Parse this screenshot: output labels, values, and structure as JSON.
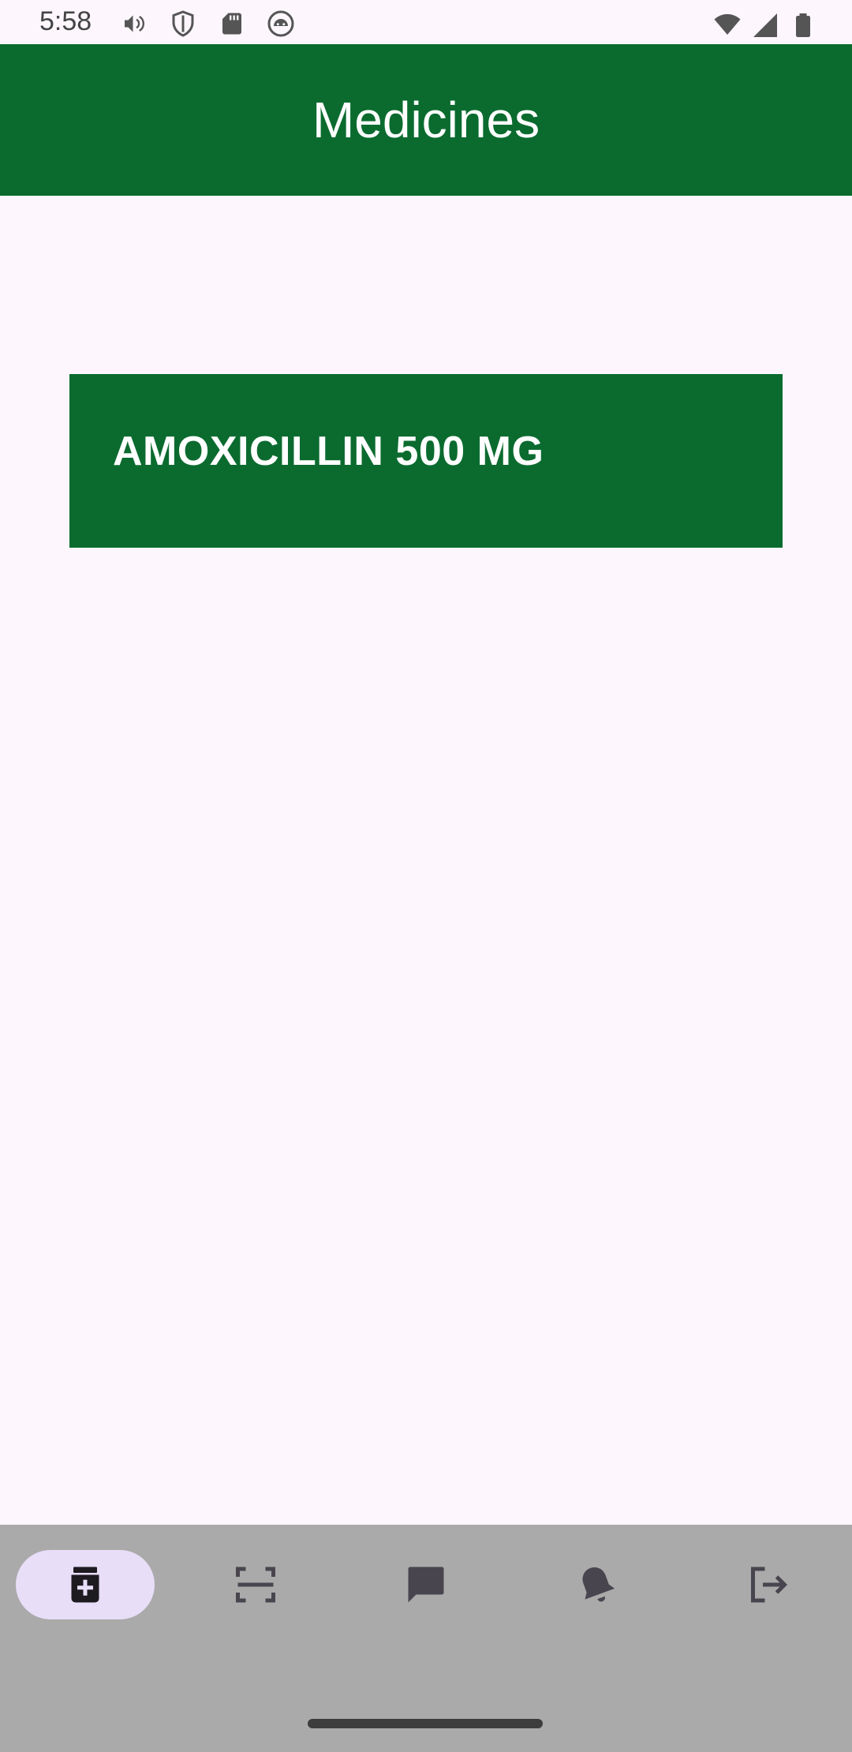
{
  "status_bar": {
    "time": "5:58",
    "left_icons": [
      "volume-icon",
      "shield-icon",
      "sd-card-icon",
      "android-face-icon"
    ],
    "right_icons": [
      "wifi-icon",
      "cell-signal-icon",
      "battery-icon"
    ]
  },
  "app_bar": {
    "title": "Medicines"
  },
  "medicines": [
    {
      "name": "AMOXICILLIN 500 MG"
    }
  ],
  "bottom_nav": {
    "items": [
      {
        "icon": "medicine-bottle-icon",
        "active": true
      },
      {
        "icon": "scan-icon",
        "active": false
      },
      {
        "icon": "chat-icon",
        "active": false
      },
      {
        "icon": "bell-icon",
        "active": false
      },
      {
        "icon": "logout-icon",
        "active": false
      }
    ]
  },
  "colors": {
    "primary": "#0b6b2f",
    "background": "#fdf7fd",
    "nav_background": "#aaaaaa",
    "nav_active_pill": "#e8def8"
  }
}
